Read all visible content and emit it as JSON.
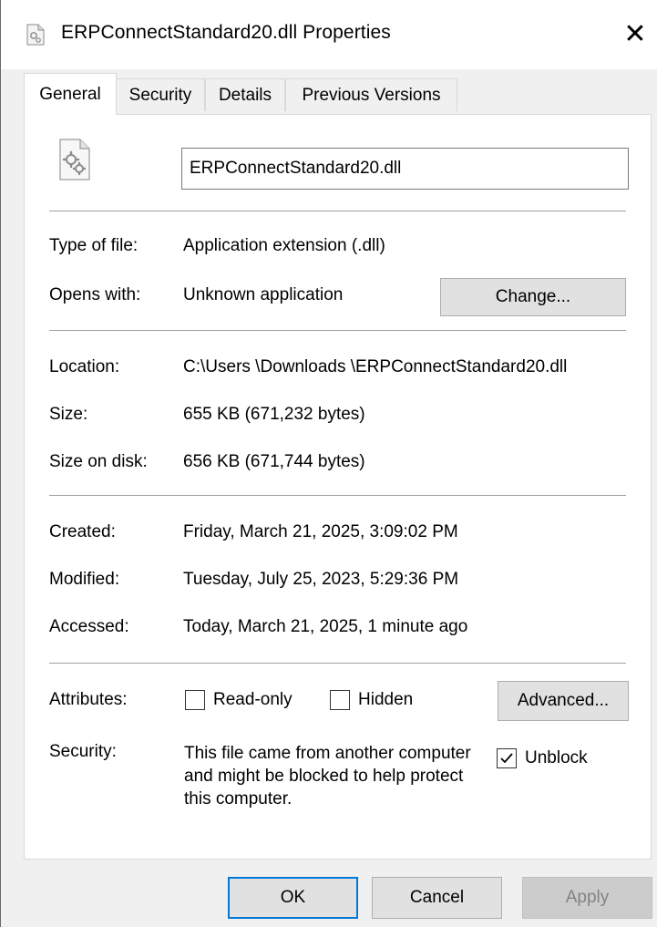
{
  "window": {
    "title": "ERPConnectStandard20.dll Properties",
    "close_glyph": "✕"
  },
  "tabs": [
    {
      "label": "General",
      "active": true
    },
    {
      "label": "Security",
      "active": false
    },
    {
      "label": "Details",
      "active": false
    },
    {
      "label": "Previous Versions",
      "active": false
    }
  ],
  "general": {
    "file_name": "ERPConnectStandard20.dll",
    "type_label": "Type of file:",
    "type_value": "Application extension (.dll)",
    "opens_label": "Opens with:",
    "opens_value": "Unknown application",
    "change_button": "Change...",
    "location_label": "Location:",
    "location_value": "C:\\Users \\Downloads \\ERPConnectStandard20.dll",
    "size_label": "Size:",
    "size_value": "655 KB (671,232 bytes)",
    "size_on_disk_label": "Size on disk:",
    "size_on_disk_value": "656 KB (671,744 bytes)",
    "created_label": "Created:",
    "created_value": "Friday, March 21, 2025, 3:09:02 PM",
    "modified_label": "Modified:",
    "modified_value": "Tuesday, July 25, 2023, 5:29:36 PM",
    "accessed_label": "Accessed:",
    "accessed_value": "Today, March 21, 2025, 1 minute ago",
    "attributes_label": "Attributes:",
    "readonly_label": "Read-only",
    "readonly_checked": false,
    "hidden_label": "Hidden",
    "hidden_checked": false,
    "advanced_button": "Advanced...",
    "security_label": "Security:",
    "security_text": "This file came from another computer and might be blocked to help protect this computer.",
    "unblock_label": "Unblock",
    "unblock_checked": true
  },
  "footer": {
    "ok": "OK",
    "cancel": "Cancel",
    "apply": "Apply",
    "apply_enabled": false
  },
  "colors": {
    "dialog_bg": "#f0f0f0",
    "panel_bg": "#ffffff",
    "default_button_border": "#0078d7",
    "disabled_text": "#838383"
  },
  "icons": {
    "title_icon": "dll-file-icon",
    "file_icon": "dll-file-gears-icon",
    "close": "close-icon",
    "checkmark": "checkmark-icon"
  }
}
